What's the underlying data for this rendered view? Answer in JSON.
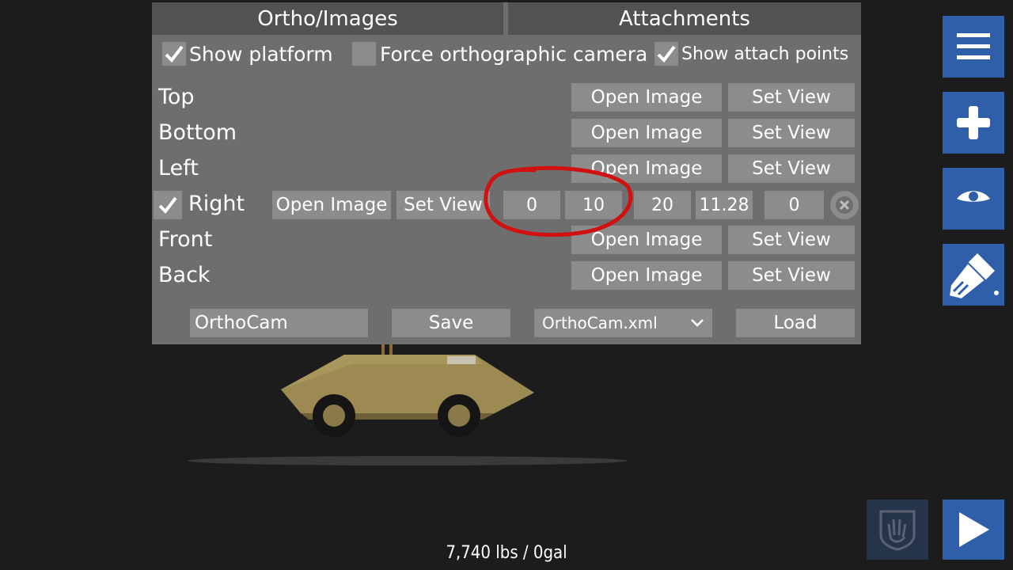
{
  "tabs": [
    {
      "label": "Ortho/Images"
    },
    {
      "label": "Attachments"
    }
  ],
  "options": {
    "show_platform": {
      "label": "Show platform",
      "checked": true
    },
    "force_ortho": {
      "label": "Force orthographic camera",
      "checked": false
    },
    "show_attach": {
      "label": "Show attach points",
      "checked": true
    }
  },
  "views": {
    "top": {
      "label": "Top",
      "open": "Open Image",
      "set": "Set View"
    },
    "bottom": {
      "label": "Bottom",
      "open": "Open Image",
      "set": "Set View"
    },
    "left": {
      "label": "Left",
      "open": "Open Image",
      "set": "Set View"
    },
    "right": {
      "label": "Right",
      "checked": true,
      "open": "Open Image",
      "set": "Set View",
      "fields": [
        "0",
        "10",
        "20",
        "11.28",
        "0"
      ]
    },
    "front": {
      "label": "Front",
      "open": "Open Image",
      "set": "Set View"
    },
    "back": {
      "label": "Back",
      "open": "Open Image",
      "set": "Set View"
    }
  },
  "footer": {
    "name_value": "OrthoCam",
    "save": "Save",
    "file_selected": "OrthoCam.xml",
    "load": "Load"
  },
  "sidebar": {
    "icons": [
      "menu-icon",
      "plus-icon",
      "eye-icon",
      "paintbrush-icon",
      "hand-icon",
      "play-icon"
    ],
    "accent": "#2f5fa8"
  },
  "status": "7,740 lbs / 0gal"
}
